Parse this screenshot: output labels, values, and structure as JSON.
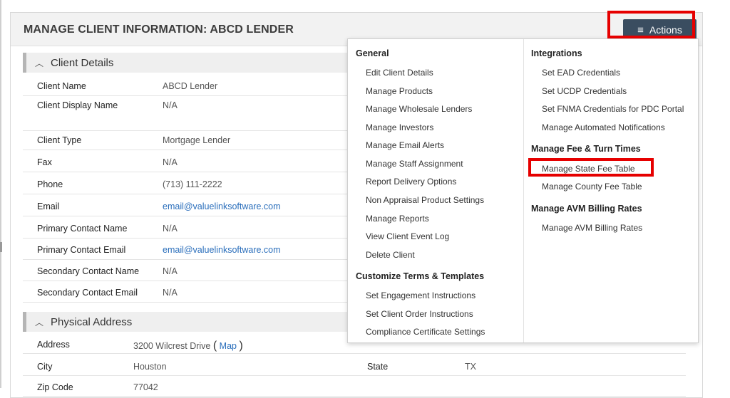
{
  "page": {
    "title": "MANAGE CLIENT INFORMATION: ABCD LENDER"
  },
  "actions": {
    "label": "Actions",
    "icon": "hamburger-icon"
  },
  "client_details": {
    "title": "Client Details",
    "rows": [
      {
        "label": "Client Name",
        "value": "ABCD Lender"
      },
      {
        "label": "Client Display Name",
        "value": "N/A"
      },
      {
        "label": "Client Type",
        "value": "Mortgage Lender"
      },
      {
        "label": "Fax",
        "value": "N/A"
      },
      {
        "label": "Phone",
        "value": "(713) 111-2222"
      },
      {
        "label": "Email",
        "value": "email@valuelinksoftware.com"
      },
      {
        "label": "Primary Contact Name",
        "value": "N/A"
      },
      {
        "label": "Primary Contact Email",
        "value": "email@valuelinksoftware.com"
      },
      {
        "label": "Secondary Contact Name",
        "value": "N/A"
      },
      {
        "label": "Secondary Contact Email",
        "value": "N/A"
      }
    ]
  },
  "physical_address": {
    "title": "Physical Address",
    "address_label": "Address",
    "address_value": "3200 Wilcrest Drive",
    "map_link": "Map",
    "city_label": "City",
    "city_value": "Houston",
    "state_label": "State",
    "state_value": "TX",
    "zip_label": "Zip Code",
    "zip_value": "77042"
  },
  "menu": {
    "general": {
      "title": "General",
      "items": [
        "Edit Client Details",
        "Manage Products",
        "Manage Wholesale Lenders",
        "Manage Investors",
        "Manage Email Alerts",
        "Manage Staff Assignment",
        "Report Delivery Options",
        "Non Appraisal Product Settings",
        "Manage Reports",
        "View Client Event Log",
        "Delete Client"
      ]
    },
    "customize": {
      "title": "Customize Terms & Templates",
      "items": [
        "Set Engagement Instructions",
        "Set Client Order Instructions",
        "Compliance Certificate Settings"
      ]
    },
    "integrations": {
      "title": "Integrations",
      "items": [
        "Set EAD Credentials",
        "Set UCDP Credentials",
        "Set FNMA Credentials for PDC Portal",
        "Manage Automated Notifications"
      ]
    },
    "fee_turn": {
      "title": "Manage Fee & Turn Times",
      "items": [
        "Manage State Fee Table",
        "Manage County Fee Table"
      ]
    },
    "avm": {
      "title": "Manage AVM Billing Rates",
      "items": [
        "Manage AVM Billing Rates"
      ]
    }
  },
  "colors": {
    "accent": "#3a4d60",
    "highlight": "#e60000",
    "link": "#2a6ebb"
  }
}
